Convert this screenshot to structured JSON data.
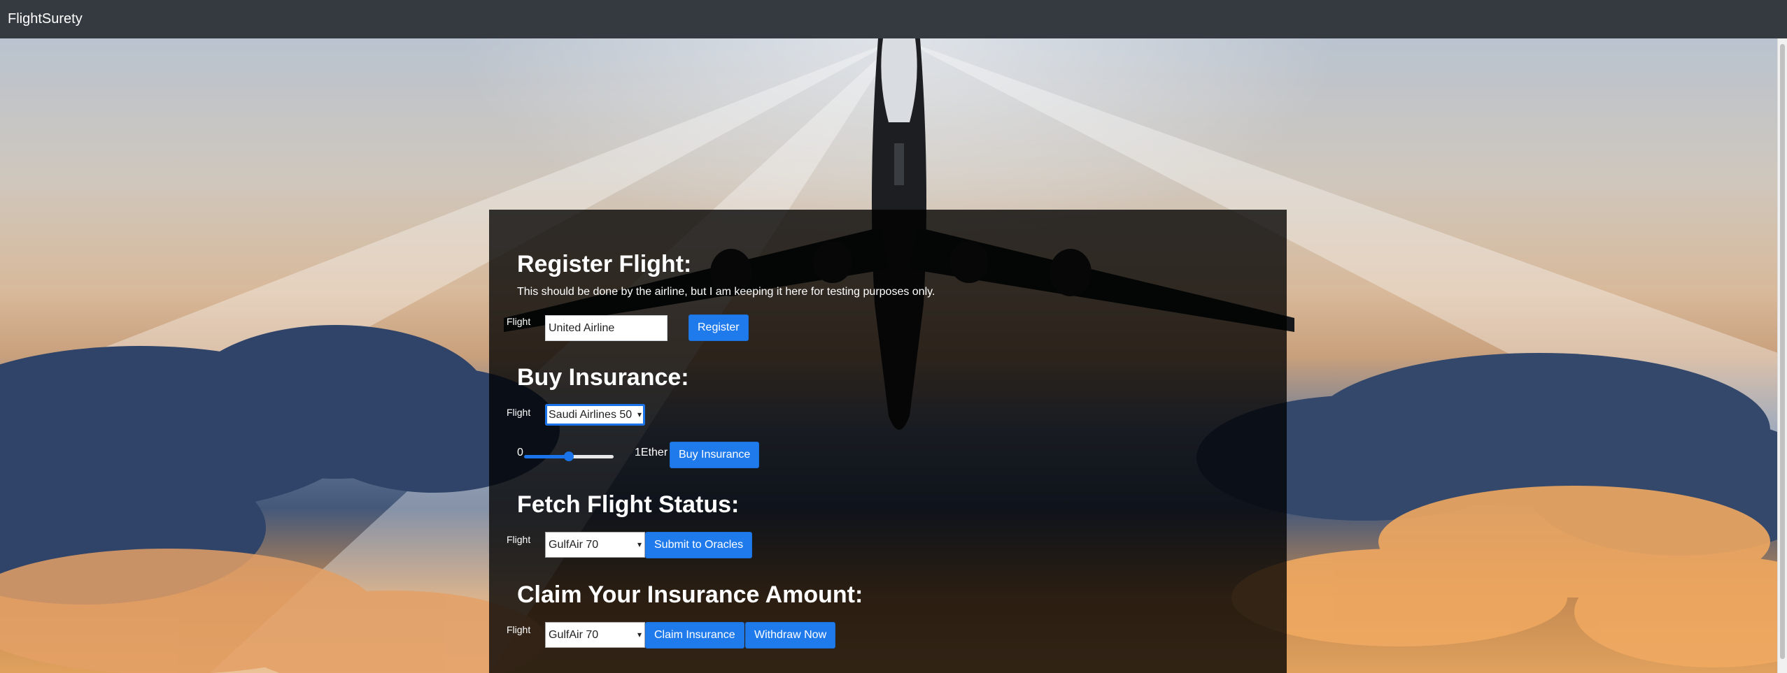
{
  "navbar": {
    "brand": "FlightSurety"
  },
  "register": {
    "heading": "Register Flight:",
    "note": "This should be done by the airline, but I am keeping it here for testing purposes only.",
    "flight_label": "Flight",
    "flight_value": "United Airline",
    "button": "Register"
  },
  "buy": {
    "heading": "Buy Insurance:",
    "flight_label": "Flight",
    "flight_selected": "Saudi Airlines 50",
    "slider_min": "0",
    "slider_max": "1Ether",
    "slider_level": 0.5,
    "button": "Buy Insurance"
  },
  "status": {
    "heading": "Fetch Flight Status:",
    "flight_label": "Flight",
    "flight_selected": "GulfAir 70",
    "button": "Submit to Oracles"
  },
  "claim": {
    "heading": "Claim Your Insurance Amount:",
    "flight_label": "Flight",
    "flight_selected": "GulfAir 70",
    "claim_button": "Claim Insurance",
    "withdraw_button": "Withdraw Now"
  },
  "colors": {
    "navbar": "#343a40",
    "button": "#1f7aec",
    "panel": "rgba(0,0,0,0.78)"
  }
}
